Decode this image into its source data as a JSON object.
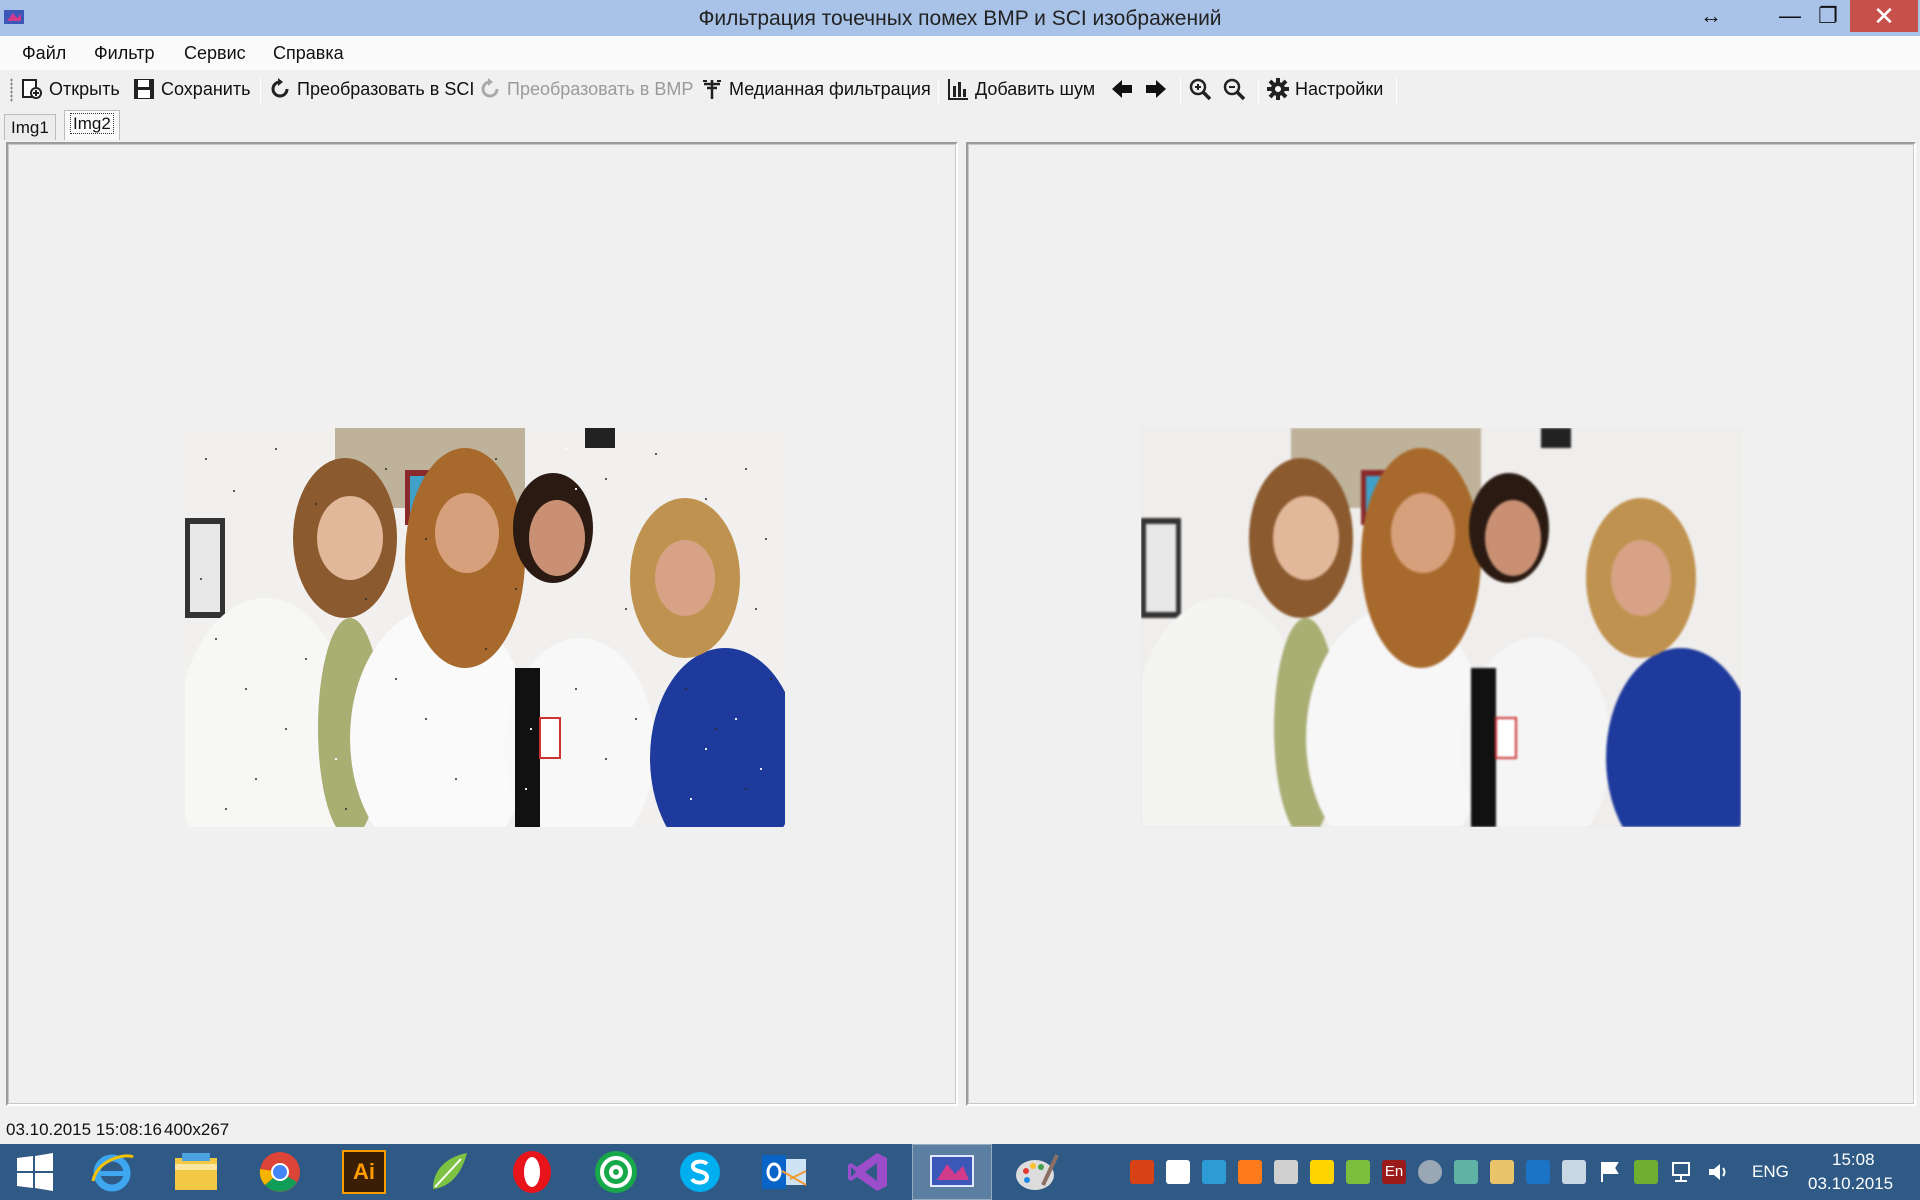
{
  "window": {
    "title": "Фильтрация точечных помех BMP и SCI изображений",
    "close_glyph": "✕",
    "maximize_glyph": "❐",
    "minimize_glyph": "—",
    "resize_glyph": "↔"
  },
  "menu": {
    "file": "Файл",
    "filter": "Фильтр",
    "service": "Сервис",
    "help": "Справка"
  },
  "toolbar": {
    "open": "Открыть",
    "save": "Сохранить",
    "to_sci": "Преобразовать в SCI",
    "to_bmp": "Преобразовать в BMP",
    "median": "Медианная фильтрация",
    "add_noise": "Добавить шум",
    "settings": "Настройки"
  },
  "tabs": {
    "img1": "Img1",
    "img2": "Img2",
    "active": "img2"
  },
  "status": {
    "datetime": "03.10.2015 15:08:16",
    "size": "400x267"
  },
  "taskbar": {
    "apps": [
      "windows-start",
      "internet-explorer",
      "file-explorer",
      "chrome",
      "illustrator",
      "corel",
      "opera",
      "mail-ru-agent",
      "skype",
      "outlook",
      "visual-studio",
      "this-app",
      "paint"
    ],
    "illustrator_label": "Ai",
    "tray_en": "En",
    "lang": "ENG",
    "time": "15:08",
    "date": "03.10.2015"
  },
  "colors": {
    "titlebar": "#a9c3e8",
    "close": "#c7504b",
    "taskbar": "#2f5a86"
  }
}
